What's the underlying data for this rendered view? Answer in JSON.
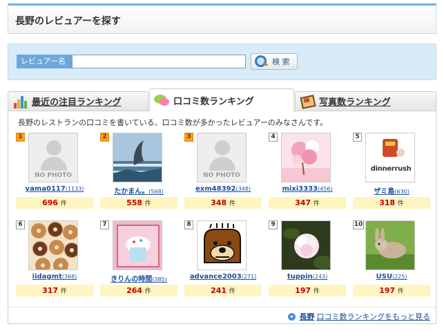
{
  "page_title": "長野のレビュアーを探す",
  "search": {
    "label": "レビュアー名",
    "placeholder": "",
    "button_label": "検 索"
  },
  "tabs": [
    {
      "label": "最近の注目ランキング",
      "icon": "bar-chart-icon",
      "active": false
    },
    {
      "label": "口コミ数ランキング",
      "icon": "speech-bubbles-icon",
      "active": true
    },
    {
      "label": "写真数ランキング",
      "icon": "photo-icon",
      "active": false
    }
  ],
  "description": "長野のレストランの口コミを書いている、口コミ数が多かったレビュアーのみなさんです。",
  "count_unit": "件",
  "reviewers": [
    {
      "rank": "1",
      "name": "yama0117",
      "sub": "(1133)",
      "count": "696",
      "photo": "no-photo"
    },
    {
      "rank": "2",
      "name": "たかまん。",
      "sub": "(568)",
      "count": "558",
      "photo": "dolphin"
    },
    {
      "rank": "3",
      "name": "exm48392",
      "sub": "(348)",
      "count": "348",
      "photo": "no-photo"
    },
    {
      "rank": "4",
      "name": "mixi3333",
      "sub": "(456)",
      "count": "347",
      "photo": "pink-flower"
    },
    {
      "rank": "5",
      "name": "ザミ島",
      "sub": "(630)",
      "count": "318",
      "photo": "dinner-rush"
    },
    {
      "rank": "6",
      "name": "iidagmt",
      "sub": "(368)",
      "count": "317",
      "photo": "donuts"
    },
    {
      "rank": "7",
      "name": "きりんの時間",
      "sub": "(385)",
      "count": "264",
      "photo": "cupcake"
    },
    {
      "rank": "8",
      "name": "advance2003",
      "sub": "(271)",
      "count": "241",
      "photo": "bear"
    },
    {
      "rank": "9",
      "name": "tuppin",
      "sub": "(243)",
      "count": "197",
      "photo": "camellia"
    },
    {
      "rank": "10",
      "name": "USU",
      "sub": "(225)",
      "count": "197",
      "photo": "rabbit"
    }
  ],
  "no_photo_label": "NO PHOTO",
  "dinner_rush_text": "dinnerrush",
  "more_link": {
    "area": "長野",
    "label": "口コミ数ランキングをもっと見る"
  },
  "colors": {
    "accent_blue": "#6fb3e4",
    "count_red": "#c00000",
    "count_bg": "#fef5c0",
    "rank_top": "#f7a21b",
    "link": "#1a4fa0"
  }
}
